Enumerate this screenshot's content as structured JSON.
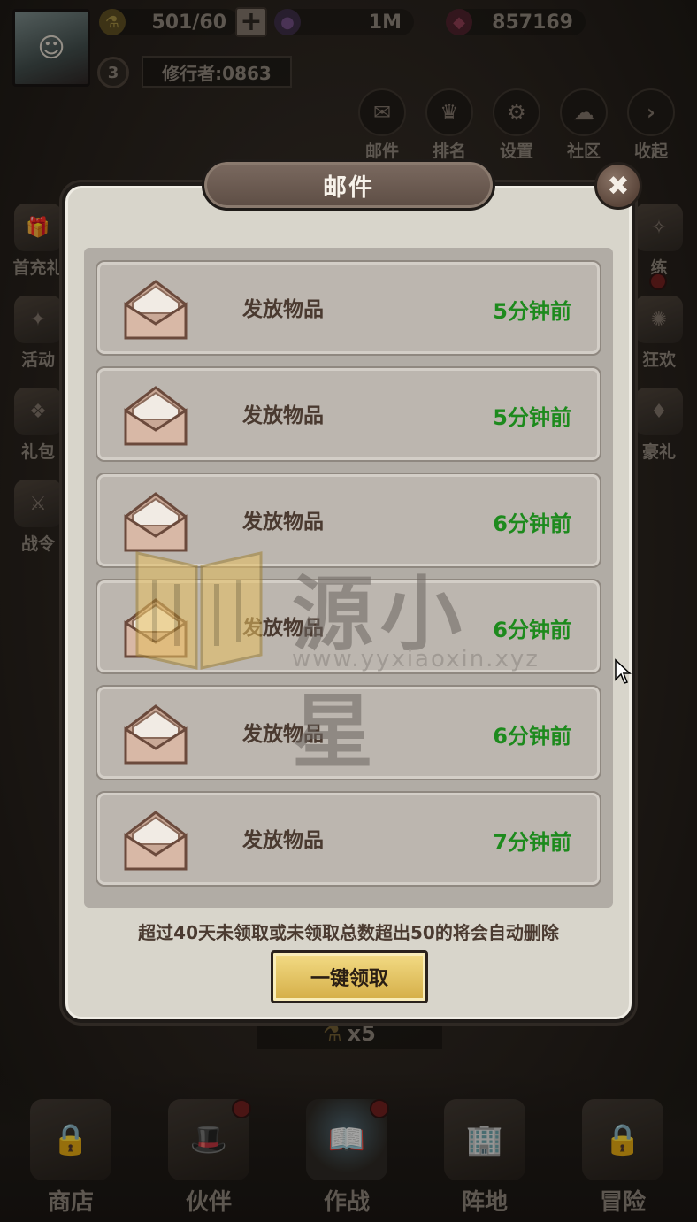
{
  "player": {
    "level": "3",
    "name": "修行者:0863"
  },
  "resources": {
    "stamina": "501/60",
    "gold": "1M",
    "gems": "857169"
  },
  "top_menu": [
    {
      "label": "邮件",
      "icon": "mail-icon"
    },
    {
      "label": "排名",
      "icon": "ranking-icon"
    },
    {
      "label": "设置",
      "icon": "settings-icon"
    },
    {
      "label": "社区",
      "icon": "community-icon"
    },
    {
      "label": "收起",
      "icon": "collapse-icon"
    }
  ],
  "side_left": [
    {
      "label": "首充礼"
    },
    {
      "label": "活动"
    },
    {
      "label": "礼包"
    },
    {
      "label": "战令"
    }
  ],
  "side_right": [
    {
      "label": "练"
    },
    {
      "label": "狂欢"
    },
    {
      "label": "豪礼"
    }
  ],
  "reward_strip": {
    "count": "x5"
  },
  "bottom_nav": [
    {
      "label": "商店"
    },
    {
      "label": "伙伴"
    },
    {
      "label": "作战"
    },
    {
      "label": "阵地"
    },
    {
      "label": "冒险"
    }
  ],
  "mail_dialog": {
    "title": "邮件",
    "close_symbol": "✖",
    "mails": [
      {
        "title": "发放物品",
        "time": "5分钟前"
      },
      {
        "title": "发放物品",
        "time": "5分钟前"
      },
      {
        "title": "发放物品",
        "time": "6分钟前"
      },
      {
        "title": "发放物品",
        "time": "6分钟前"
      },
      {
        "title": "发放物品",
        "time": "6分钟前"
      },
      {
        "title": "发放物品",
        "time": "7分钟前"
      }
    ],
    "footer_note": "超过40天未领取或未领取总数超出50的将会自动删除",
    "claim_all_label": "一键领取"
  },
  "watermark": {
    "text": "源小星",
    "url": "www.yyxiaoxin.xyz"
  },
  "colors": {
    "time_green": "#1d8a1d",
    "dialog_bg": "#d8d5cb",
    "claim_gold": "#d4ad46"
  }
}
